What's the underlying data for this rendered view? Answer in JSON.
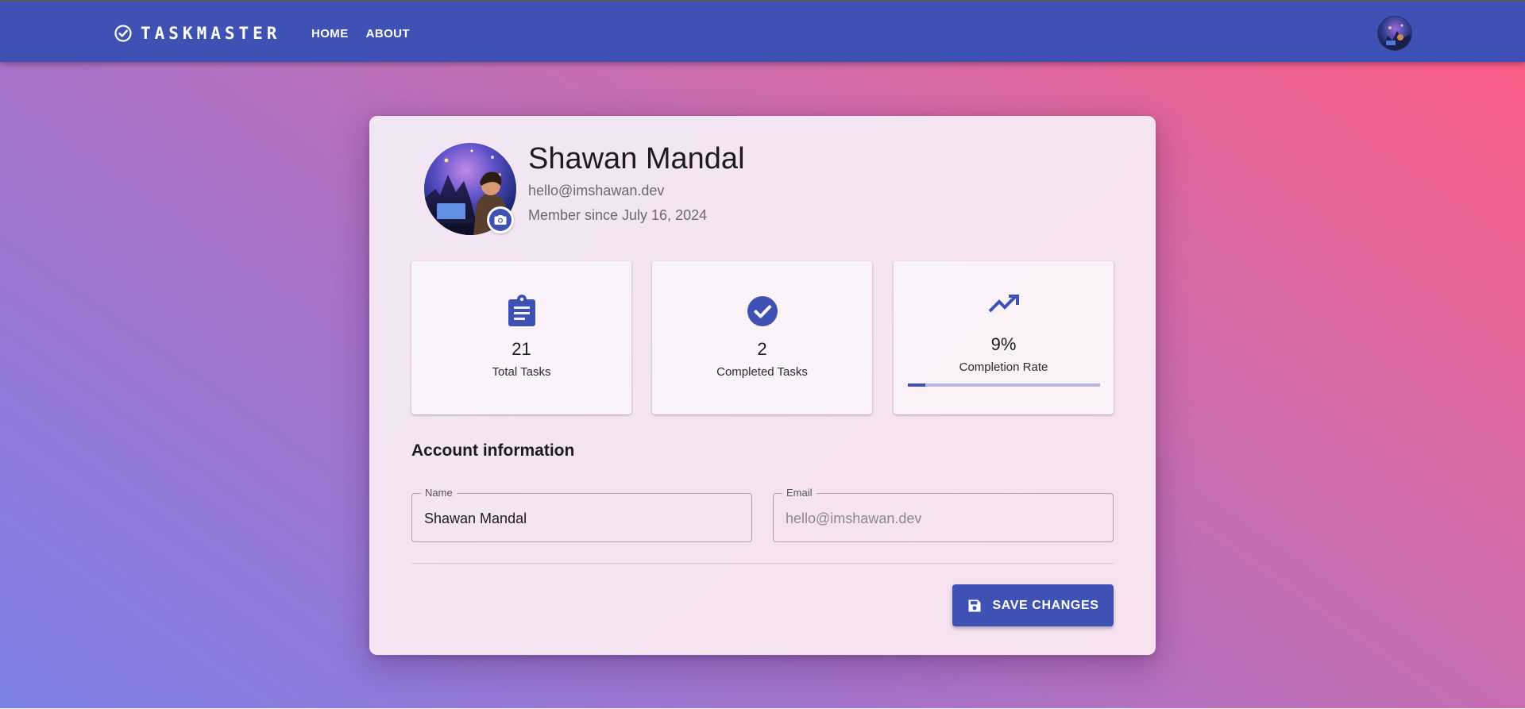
{
  "app": {
    "brand": "TASKMASTER",
    "nav": [
      {
        "label": "HOME"
      },
      {
        "label": "ABOUT"
      }
    ]
  },
  "profile": {
    "name": "Shawan Mandal",
    "email": "hello@imshawan.dev",
    "member_since": "Member since July 16, 2024"
  },
  "stats": {
    "total": {
      "value": "21",
      "label": "Total Tasks",
      "icon": "clipboard-icon"
    },
    "completed": {
      "value": "2",
      "label": "Completed Tasks",
      "icon": "check-circle-icon"
    },
    "rate": {
      "value": "9%",
      "label": "Completion Rate",
      "icon": "trending-up-icon",
      "progress": 0.09
    }
  },
  "account": {
    "title": "Account information",
    "name_label": "Name",
    "name_value": "Shawan Mandal",
    "email_label": "Email",
    "email_value": "hello@imshawan.dev"
  },
  "actions": {
    "save_label": "SAVE CHANGES"
  },
  "colors": {
    "primary": "#3f51b5",
    "progress_track": "#b3b7e3"
  }
}
